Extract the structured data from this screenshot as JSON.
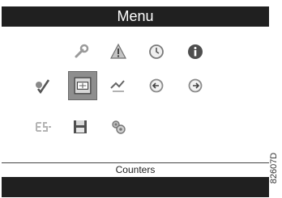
{
  "menu": {
    "title": "Menu"
  },
  "icons": {
    "row1": [
      "wrench-icon",
      "warning-icon",
      "clock-icon",
      "info-icon"
    ],
    "row2": [
      "check-settings-icon",
      "counters-icon",
      "trend-icon",
      "return-icon",
      "forward-icon"
    ],
    "row3": [
      "es-icon",
      "save-icon",
      "gears-icon"
    ]
  },
  "status": {
    "label": "Counters"
  },
  "figure": {
    "code": "82607D"
  }
}
